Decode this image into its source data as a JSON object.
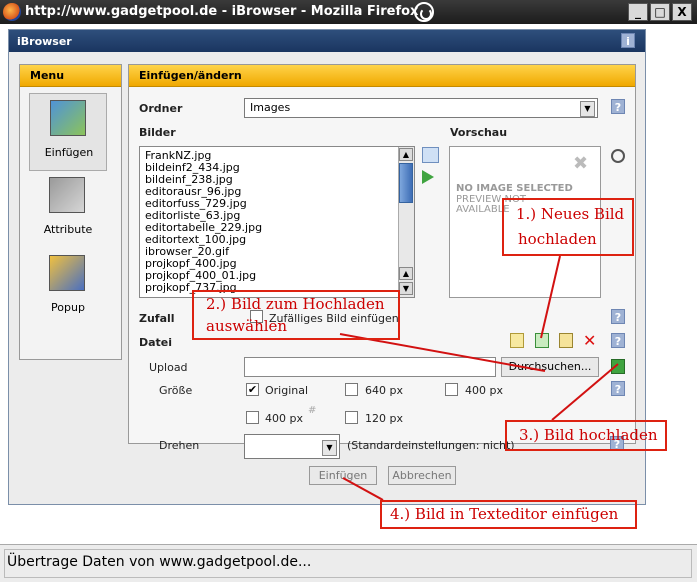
{
  "window": {
    "title": "http://www.gadgetpool.de - iBrowser - Mozilla Firefox",
    "controls": {
      "minimize": "_",
      "maximize": "□",
      "close": "X"
    }
  },
  "dialog": {
    "title": "iBrowser",
    "help_label": "i"
  },
  "menu": {
    "title": "Menu",
    "items": [
      {
        "label": "Einfügen",
        "icon": "insert-image-icon",
        "selected": true
      },
      {
        "label": "Attribute",
        "icon": "attributes-icon",
        "selected": false
      },
      {
        "label": "Popup",
        "icon": "popup-icon",
        "selected": false
      }
    ]
  },
  "main": {
    "title": "Einfügen/ändern",
    "ordner_label": "Ordner",
    "ordner_value": "Images",
    "bilder_label": "Bilder",
    "vorschau_label": "Vorschau",
    "files": [
      "FrankNZ.jpg",
      "bildeinf2_434.jpg",
      "bildeinf_238.jpg",
      "editorausr_96.jpg",
      "editorfuss_729.jpg",
      "editorliste_63.jpg",
      "editortabelle_229.jpg",
      "editortext_100.jpg",
      "ibrowser_20.gif",
      "projkopf_400.jpg",
      "projkopf_400_01.jpg",
      "projkopf_737.jpg"
    ],
    "preview_line1": "NO IMAGE SELECTED",
    "preview_line2": "PREVIEW NOT",
    "preview_line3": "AVAILABLE",
    "zufall_label": "Zufall",
    "zufall_checkbox_label": "Zufälliges Bild einfügen",
    "datei_label": "Datei",
    "upload_label": "Upload",
    "browse_button": "Durchsuchen...",
    "groesse_label": "Größe",
    "size_options": [
      {
        "label": "Original",
        "checked": true
      },
      {
        "label": "640 px",
        "checked": false
      },
      {
        "label": "400 px",
        "checked": false
      },
      {
        "label": "400 px",
        "checked": false
      },
      {
        "label": "120 px",
        "checked": false
      }
    ],
    "drehen_label": "Drehen",
    "drehen_hint": "(Standardeinstellungen: nicht)",
    "insert_button": "Einfügen",
    "cancel_button": "Abbrechen",
    "help_label": "?"
  },
  "annotations": {
    "step1_line1": "1.) Neues Bild",
    "step1_line2": "hochladen",
    "step2_line1": "2.) Bild zum Hochladen",
    "step2_line2": "auswählen",
    "step3": "3.) Bild hochladen",
    "step4": "4.) Bild in Texteditor einfügen",
    "color": "#d21111"
  },
  "status": {
    "text": "Übertrage Daten von www.gadgetpool.de..."
  }
}
